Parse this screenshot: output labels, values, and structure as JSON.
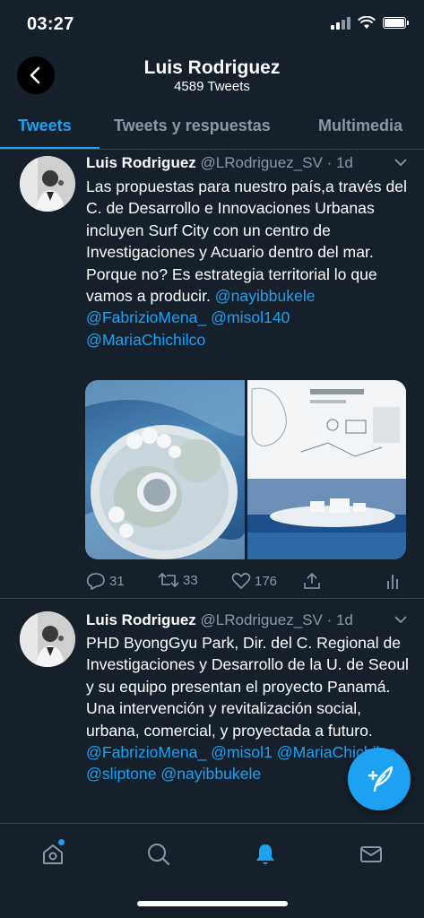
{
  "status_bar": {
    "time": "03:27"
  },
  "header": {
    "title": "Luis Rodriguez",
    "subtitle": "4589 Tweets"
  },
  "tabs": [
    {
      "label": "Tweets",
      "active": true
    },
    {
      "label": "Tweets y respuestas",
      "active": false
    },
    {
      "label": "Multimedia",
      "active": false
    }
  ],
  "tweets": [
    {
      "name": "Luis Rodriguez",
      "handle": "@LRodriguez_SV",
      "time": "· 1d",
      "text": "Las propuestas para nuestro país,a través del C. de Desarrollo e Innovaciones Urbanas incluyen Surf City con un centro de Investigaciones y Acuario dentro del mar. Porque no? Es estrategia territorial lo que vamos a producir.",
      "mentions": [
        "@nayibbukele",
        "@FabrizioMena_",
        "@misol140",
        "@MariaChichilco"
      ],
      "replies": "31",
      "retweets": "33",
      "likes": "176"
    },
    {
      "name": "Luis Rodriguez",
      "handle": "@LRodriguez_SV",
      "time": "· 1d",
      "text": "PHD ByongGyu Park, Dir. del C. Regional de Investigaciones y Desarrollo de la U. de Seoul y su equipo presentan el proyecto Panamá. Una intervención y revitalización social, urbana, comercial, y proyectada a futuro.",
      "mentions": [
        "@FabrizioMena_",
        "@misol1",
        "@MariaChichilco",
        "@sliptone",
        "@nayibbukele"
      ]
    }
  ],
  "bottom_nav": [
    "home-icon",
    "search-icon",
    "notifications-icon",
    "messages-icon"
  ],
  "colors": {
    "background": "#15202b",
    "accent": "#1da1f2",
    "muted": "#8899a6",
    "divider": "#38444d"
  }
}
